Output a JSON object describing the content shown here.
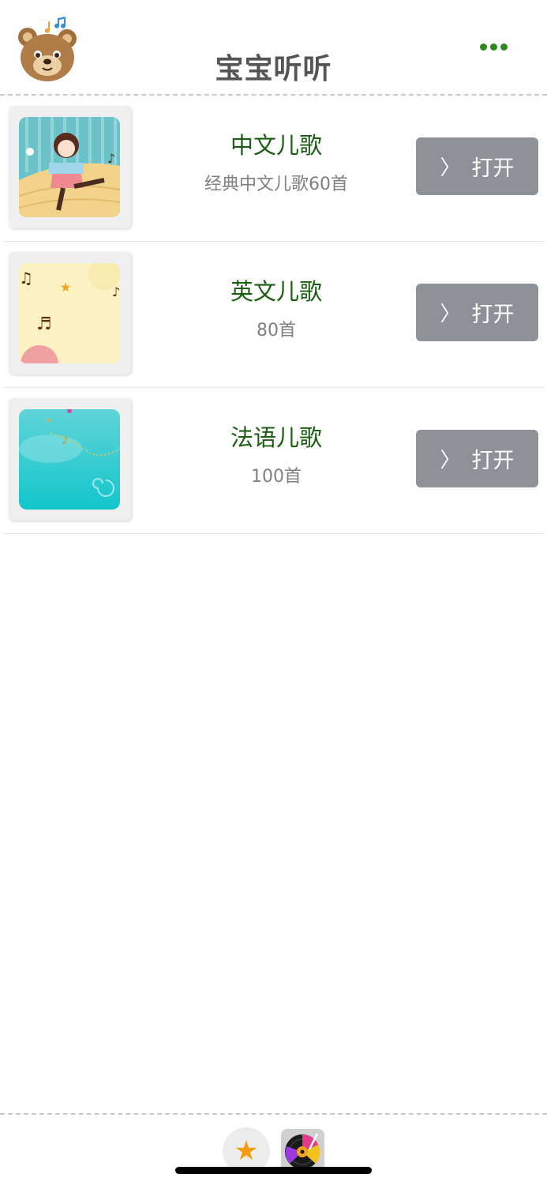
{
  "header": {
    "title": "宝宝听听",
    "app_icon": "bear-music-icon",
    "menu_icon": "more-dots-icon",
    "accent_color": "#2f8a1e"
  },
  "list": [
    {
      "title": "中文儿歌",
      "subtitle": "经典中文儿歌60首",
      "button_chevron": "〉",
      "button_label": "打开",
      "thumb": "girl-dancing-illustration"
    },
    {
      "title": "英文儿歌",
      "subtitle": "80首",
      "button_chevron": "〉",
      "button_label": "打开",
      "thumb": "music-notes-yellow-illustration"
    },
    {
      "title": "法语儿歌",
      "subtitle": "100首",
      "button_chevron": "〉",
      "button_label": "打开",
      "thumb": "cyan-music-wave-illustration"
    }
  ],
  "bottom": {
    "favorite_icon": "star-icon",
    "star_glyph": "★",
    "player_icon": "vinyl-record-icon"
  }
}
